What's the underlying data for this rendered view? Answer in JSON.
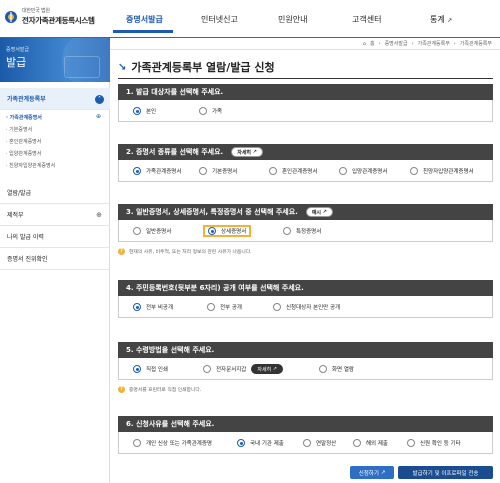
{
  "header": {
    "logo_small": "대한민국 법원",
    "logo_main": "전자가족관계등록시스템",
    "nav": [
      {
        "label": "증명서발급",
        "active": true
      },
      {
        "label": "인터넷신고",
        "active": false
      },
      {
        "label": "민원안내",
        "active": false
      },
      {
        "label": "고객센터",
        "active": false
      },
      {
        "label": "통계",
        "active": false
      }
    ],
    "nav_external_glyph": "↗"
  },
  "breadcrumb": [
    "홈",
    "증명서발급",
    "가족관계등록부",
    "가족관계등록부"
  ],
  "sidebar": {
    "banner_small": "증명서발급",
    "banner_big": "발급",
    "menu": [
      {
        "label": "가족관계등록부",
        "open": true
      },
      {
        "label": "제적부",
        "open": false
      },
      {
        "label": "나의 발급 이력",
        "open": false
      },
      {
        "label": "증명서 진위확인",
        "open": false
      }
    ],
    "submenu": [
      {
        "label": "· 가족관계증명서",
        "active": true
      },
      {
        "label": "· 기본증명서",
        "active": false
      },
      {
        "label": "· 혼인관계증명서",
        "active": false
      },
      {
        "label": "· 입양관계증명서",
        "active": false
      },
      {
        "label": "· 친양자입양관계증명서",
        "active": false
      }
    ],
    "extra_item": "열람/발급"
  },
  "main": {
    "title": "가족관계등록부 열람/발급 신청",
    "sections": [
      {
        "heading": "1. 발급 대상자를 선택해 주세요.",
        "options": [
          "본인",
          "가족"
        ],
        "selected": 0
      },
      {
        "heading": "2. 증명서 종류를 선택해 주세요.",
        "detail": "자세히",
        "options": [
          "가족관계증명서",
          "기본증명서",
          "혼인관계증명서",
          "입양관계증명서",
          "친양자입양관계증명서"
        ],
        "selected": 0
      },
      {
        "heading": "3. 일반증명서, 상세증명서, 특정증명서 중 선택해 주세요.",
        "detail": "예시",
        "options": [
          "일반증명서",
          "상세증명서",
          "특정증명서"
        ],
        "selected": 1
      },
      {
        "heading": "4. 주민등록번호(뒷부분 6자리) 공개 여부를 선택해 주세요.",
        "options": [
          "전부 비공개",
          "전부 공개",
          "신청대상자 본인만 공개"
        ],
        "selected": 0
      },
      {
        "heading": "5. 수령방법을 선택해 주세요.",
        "detail": "자세히",
        "options": [
          "직접 인쇄",
          "전자문서지갑",
          "화면 열람"
        ],
        "selected": 0
      },
      {
        "heading": "6. 신청사유를 선택해 주세요.",
        "options": [
          "개인 신상 또는 가족관계증명",
          "국내 기관 제출",
          "연말정산",
          "해외 제출",
          "신원 확인 등 기타"
        ],
        "selected": 1
      }
    ],
    "note3": "현재의 사유, 비주적, 또는 처리 정보의 관련 사유가 나옵니다.",
    "note5": "증명서를 프린터로 직접 인쇄합니다.",
    "btn_reset": "신청하기",
    "btn_submit": "발급하기 및 이프로파일 전송",
    "external_glyph": "↗"
  },
  "colors": {
    "primary": "#1d5bb1",
    "section_head": "#444444",
    "highlight": "#f0b23a",
    "submit_btn": "#1a4c8f",
    "reset_btn": "#2e6fc4"
  }
}
